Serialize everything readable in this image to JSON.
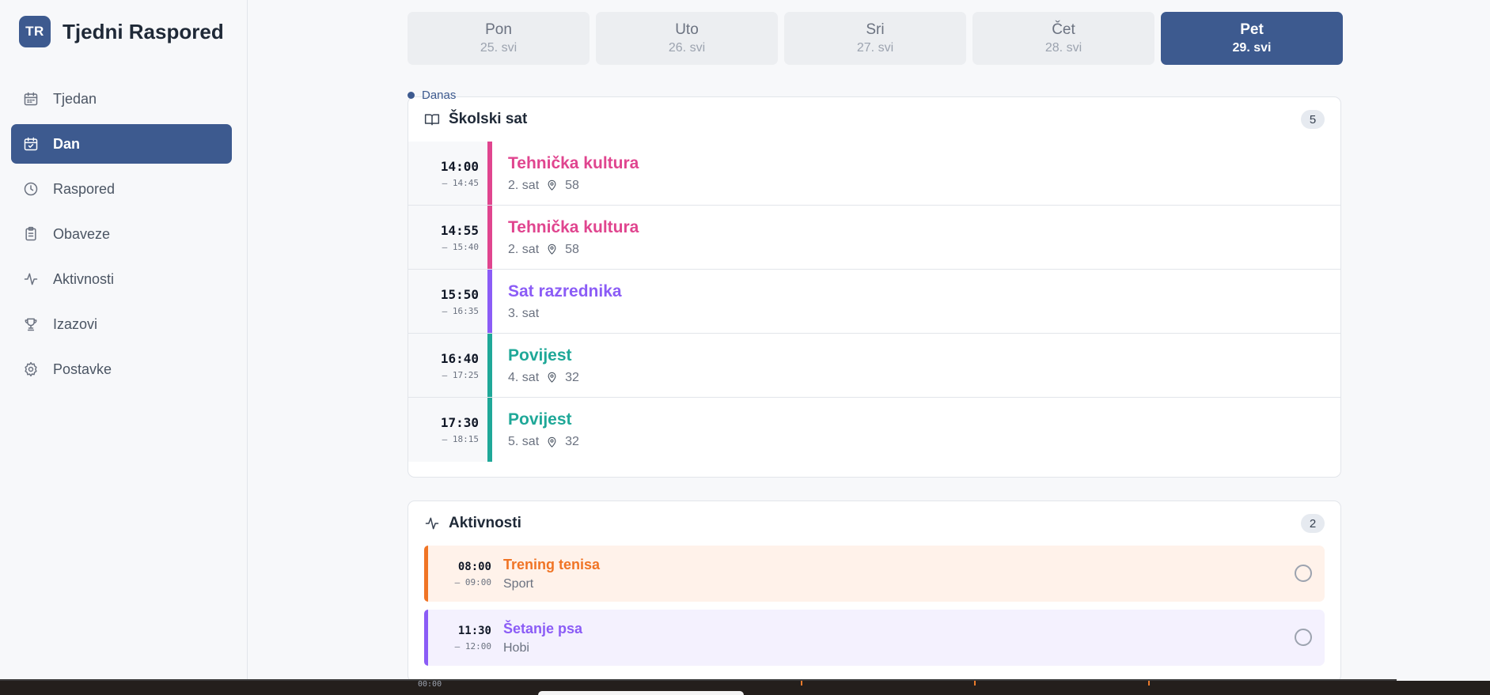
{
  "app": {
    "logo": "TR",
    "title": "Tjedni Raspored"
  },
  "sidebar": {
    "items": [
      {
        "label": "Tjedan",
        "icon": "calendar-icon",
        "active": false
      },
      {
        "label": "Dan",
        "icon": "calendar-check-icon",
        "active": true
      },
      {
        "label": "Raspored",
        "icon": "clock-icon",
        "active": false
      },
      {
        "label": "Obaveze",
        "icon": "clipboard-icon",
        "active": false
      },
      {
        "label": "Aktivnosti",
        "icon": "activity-icon",
        "active": false
      },
      {
        "label": "Izazovi",
        "icon": "trophy-icon",
        "active": false
      },
      {
        "label": "Postavke",
        "icon": "gear-icon",
        "active": false
      }
    ]
  },
  "days": [
    {
      "name": "Pon",
      "date": "25. svi",
      "active": false
    },
    {
      "name": "Uto",
      "date": "26. svi",
      "active": false
    },
    {
      "name": "Sri",
      "date": "27. svi",
      "active": false
    },
    {
      "name": "Čet",
      "date": "28. svi",
      "active": false
    },
    {
      "name": "Pet",
      "date": "29. svi",
      "active": true
    }
  ],
  "today_label": "Danas",
  "school": {
    "title": "Školski sat",
    "count": "5",
    "lessons": [
      {
        "start": "14:00",
        "end": "– 14:45",
        "name": "Tehnička kultura",
        "period": "2. sat",
        "room": "58",
        "color": "#e0458f"
      },
      {
        "start": "14:55",
        "end": "– 15:40",
        "name": "Tehnička kultura",
        "period": "2. sat",
        "room": "58",
        "color": "#e0458f"
      },
      {
        "start": "15:50",
        "end": "– 16:35",
        "name": "Sat razrednika",
        "period": "3. sat",
        "room": "",
        "color": "#8b5cf6"
      },
      {
        "start": "16:40",
        "end": "– 17:25",
        "name": "Povijest",
        "period": "4. sat",
        "room": "32",
        "color": "#1fa898"
      },
      {
        "start": "17:30",
        "end": "– 18:15",
        "name": "Povijest",
        "period": "5. sat",
        "room": "32",
        "color": "#1fa898"
      }
    ]
  },
  "activities": {
    "title": "Aktivnosti",
    "count": "2",
    "items": [
      {
        "start": "08:00",
        "end": "– 09:00",
        "name": "Trening tenisa",
        "category": "Sport",
        "color": "#f07425",
        "bg": "#fff2ea"
      },
      {
        "start": "11:30",
        "end": "– 12:00",
        "name": "Šetanje psa",
        "category": "Hobi",
        "color": "#8b5cf6",
        "bg": "#f4f1fe"
      }
    ]
  },
  "bottom": {
    "label": "00:00"
  }
}
